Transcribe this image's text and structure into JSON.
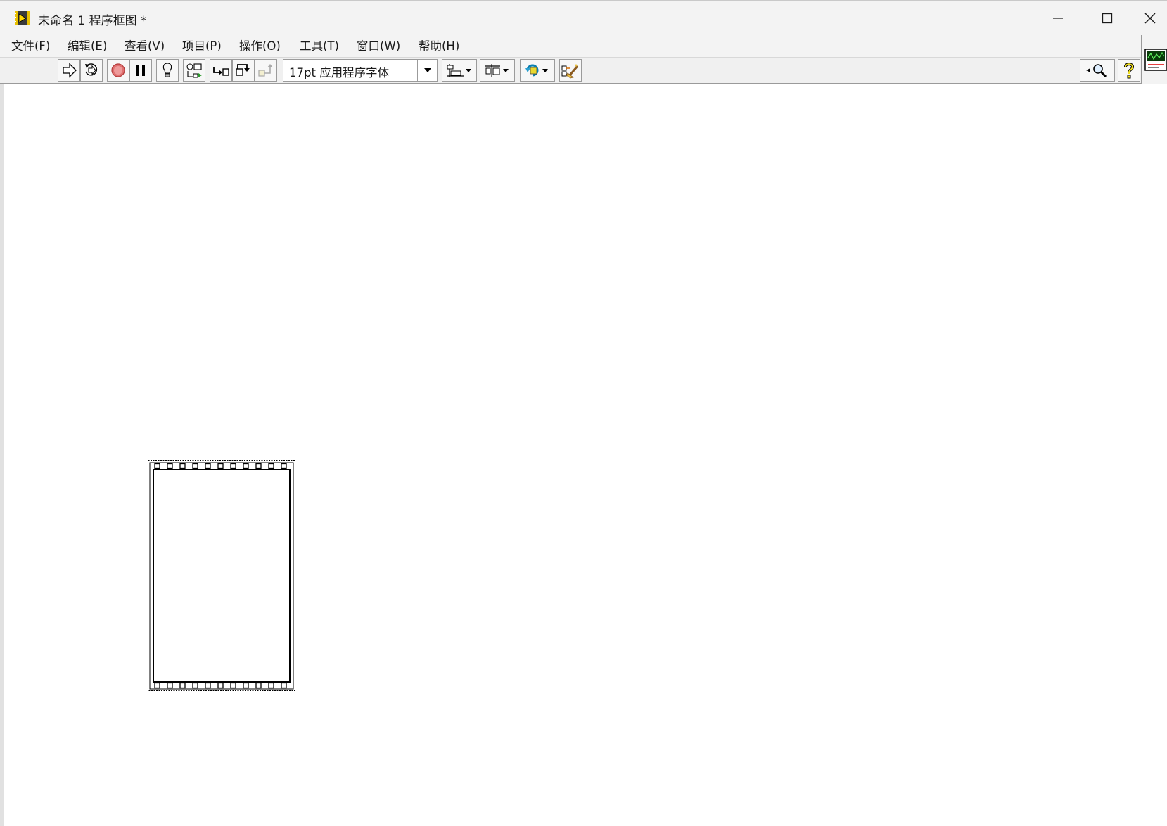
{
  "window": {
    "title": "未命名 1 程序框图 *",
    "minimize_icon": "minimize-icon",
    "maximize_icon": "maximize-icon",
    "close_icon": "close-icon"
  },
  "menubar": {
    "items": [
      {
        "label": "文件(F)"
      },
      {
        "label": "编辑(E)"
      },
      {
        "label": "查看(V)"
      },
      {
        "label": "项目(P)"
      },
      {
        "label": "操作(O)"
      },
      {
        "label": "工具(T)"
      },
      {
        "label": "窗口(W)"
      },
      {
        "label": "帮助(H)"
      }
    ]
  },
  "toolbar": {
    "font_select": {
      "value": "17pt 应用程序字体"
    },
    "icons": [
      "run-icon",
      "run-continuously-icon",
      "abort-icon",
      "pause-icon",
      "highlight-execution-icon",
      "retain-wire-values-icon",
      "step-into-icon",
      "step-over-icon",
      "step-out-icon",
      "align-objects-icon",
      "distribute-objects-icon",
      "reorder-icon",
      "clean-up-diagram-icon",
      "search-icon",
      "help-icon"
    ]
  },
  "colors": {
    "titlebar_bg": "#f3f3f3",
    "toolbar_bg": "#f0f0f0",
    "canvas_bg": "#ffffff",
    "structure_border": "#000000"
  },
  "diagram": {
    "structure": "flat-sequence-structure"
  }
}
